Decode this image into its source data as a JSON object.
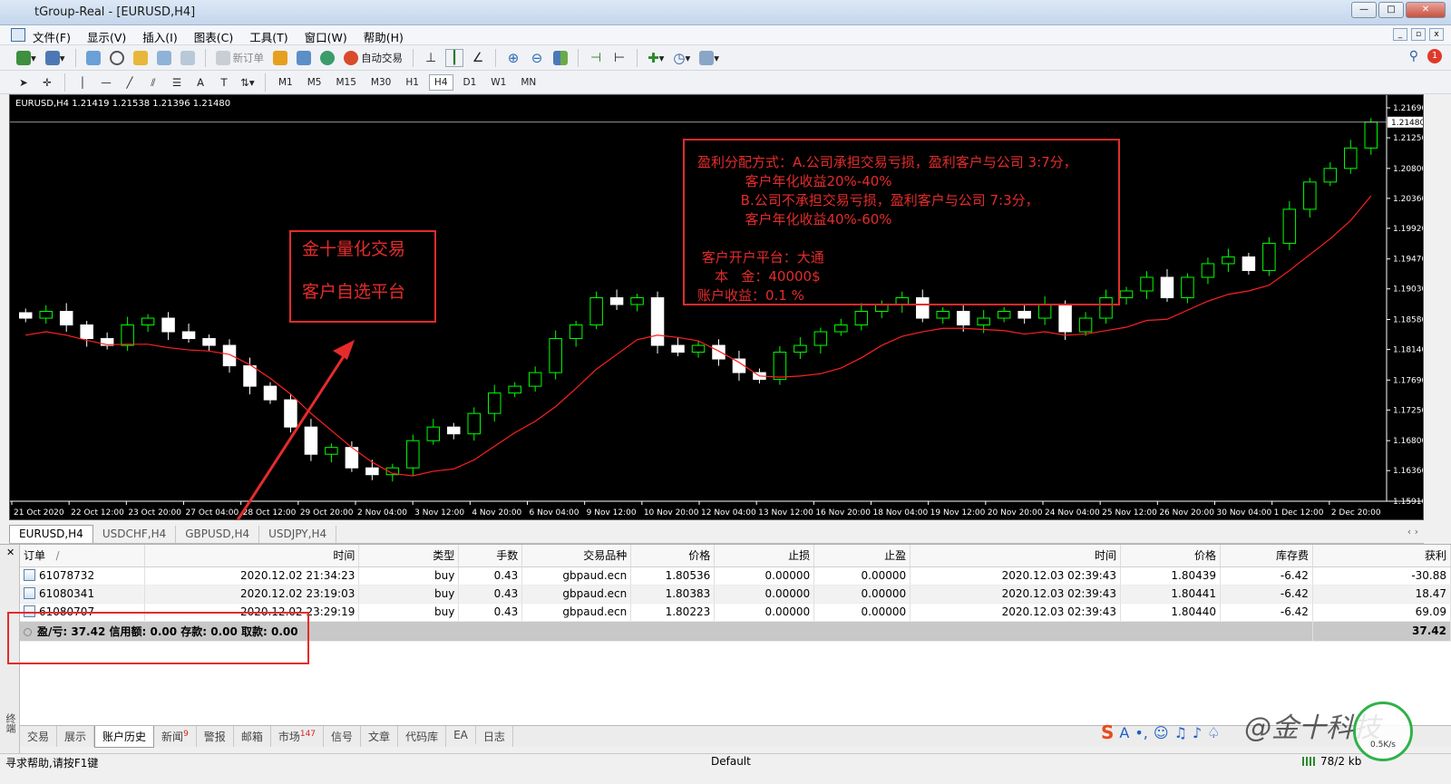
{
  "window": {
    "title": "tGroup-Real - [EURUSD,H4]"
  },
  "menu": [
    "文件(F)",
    "显示(V)",
    "插入(I)",
    "图表(C)",
    "工具(T)",
    "窗口(W)",
    "帮助(H)"
  ],
  "toolbar": {
    "new_order": "新订单",
    "auto_trading": "自动交易",
    "notify_count": "1"
  },
  "timeframes": [
    "M1",
    "M5",
    "M15",
    "M30",
    "H1",
    "H4",
    "D1",
    "W1",
    "MN"
  ],
  "active_timeframe": "H4",
  "chart": {
    "header": "EURUSD,H4  1.21419 1.21538 1.21396 1.21480",
    "current_price": "1.21480",
    "price_ticks": [
      "1.21690",
      "1.21250",
      "1.20800",
      "1.20360",
      "1.19920",
      "1.19470",
      "1.19030",
      "1.18580",
      "1.18140",
      "1.17690",
      "1.17250",
      "1.16800",
      "1.16360",
      "1.15910"
    ],
    "time_ticks": [
      "21 Oct 2020",
      "22 Oct 12:00",
      "23 Oct 20:00",
      "27 Oct 04:00",
      "28 Oct 12:00",
      "29 Oct 20:00",
      "2 Nov 04:00",
      "3 Nov 12:00",
      "4 Nov 20:00",
      "6 Nov 04:00",
      "9 Nov 12:00",
      "10 Nov 20:00",
      "12 Nov 04:00",
      "13 Nov 12:00",
      "16 Nov 20:00",
      "18 Nov 04:00",
      "19 Nov 12:00",
      "20 Nov 20:00",
      "24 Nov 04:00",
      "25 Nov 12:00",
      "26 Nov 20:00",
      "30 Nov 04:00",
      "1 Dec 12:00",
      "2 Dec 20:00"
    ],
    "colors": {
      "bull": "#00ff00",
      "bear": "#ffffff",
      "ma": "#ff2020",
      "grid_text": "#ffffff"
    }
  },
  "chart_data": {
    "type": "candlestick",
    "symbol": "EURUSD",
    "timeframe": "H4",
    "ylim": [
      1.1591,
      1.2169
    ],
    "close": [
      1.186,
      1.187,
      1.185,
      1.183,
      1.182,
      1.185,
      1.186,
      1.184,
      1.183,
      1.182,
      1.179,
      1.176,
      1.174,
      1.17,
      1.166,
      1.167,
      1.164,
      1.163,
      1.164,
      1.168,
      1.17,
      1.169,
      1.172,
      1.175,
      1.176,
      1.178,
      1.183,
      1.185,
      1.189,
      1.188,
      1.189,
      1.182,
      1.181,
      1.182,
      1.18,
      1.178,
      1.177,
      1.181,
      1.182,
      1.184,
      1.185,
      1.187,
      1.188,
      1.189,
      1.186,
      1.187,
      1.185,
      1.186,
      1.187,
      1.186,
      1.188,
      1.184,
      1.186,
      1.189,
      1.19,
      1.192,
      1.189,
      1.192,
      1.194,
      1.195,
      1.193,
      1.197,
      1.202,
      1.206,
      1.208,
      1.211,
      1.2148
    ]
  },
  "annotations": {
    "box1": {
      "line1": "金十量化交易",
      "line2": "客户自选平台"
    },
    "box2": [
      "盈利分配方式：A.公司承担交易亏损，盈利客户与公司 3:7分，",
      "           客户年化收益20%-40%",
      "          B.公司不承担交易亏损，盈利客户与公司 7:3分，",
      "           客户年化收益40%-60%",
      "",
      " 客户开户平台：大通",
      "    本   金：40000$",
      "账户收益：0.1 %"
    ]
  },
  "symbol_tabs": [
    "EURUSD,H4",
    "USDCHF,H4",
    "GBPUSD,H4",
    "USDJPY,H4"
  ],
  "terminal": {
    "columns": [
      "订单",
      "时间",
      "类型",
      "手数",
      "交易品种",
      "价格",
      "止损",
      "止盈",
      "时间",
      "价格",
      "库存费",
      "获利"
    ],
    "sort_marker": "/",
    "rows": [
      [
        "61078732",
        "2020.12.02 21:34:23",
        "buy",
        "0.43",
        "gbpaud.ecn",
        "1.80536",
        "0.00000",
        "0.00000",
        "2020.12.03 02:39:43",
        "1.80439",
        "-6.42",
        "-30.88"
      ],
      [
        "61080341",
        "2020.12.02 23:19:03",
        "buy",
        "0.43",
        "gbpaud.ecn",
        "1.80383",
        "0.00000",
        "0.00000",
        "2020.12.03 02:39:43",
        "1.80441",
        "-6.42",
        "18.47"
      ],
      [
        "61080707",
        "2020.12.02 23:29:19",
        "buy",
        "0.43",
        "gbpaud.ecn",
        "1.80223",
        "0.00000",
        "0.00000",
        "2020.12.03 02:39:43",
        "1.80440",
        "-6.42",
        "69.09"
      ]
    ],
    "summary": "盈/亏: 37.42  信用额: 0.00  存款: 0.00  取款: 0.00",
    "summary_total": "37.42",
    "side_label": "终端"
  },
  "bottom_tabs": [
    {
      "label": "交易",
      "badge": ""
    },
    {
      "label": "展示",
      "badge": ""
    },
    {
      "label": "账户历史",
      "badge": ""
    },
    {
      "label": "新闻",
      "badge": "9"
    },
    {
      "label": "警报",
      "badge": ""
    },
    {
      "label": "邮箱",
      "badge": ""
    },
    {
      "label": "市场",
      "badge": "147"
    },
    {
      "label": "信号",
      "badge": ""
    },
    {
      "label": "文章",
      "badge": ""
    },
    {
      "label": "代码库",
      "badge": ""
    },
    {
      "label": "EA",
      "badge": ""
    },
    {
      "label": "日志",
      "badge": ""
    }
  ],
  "active_bottom_tab": "账户历史",
  "status": {
    "help": "寻求帮助,请按F1键",
    "profile": "Default",
    "traffic": "78/2 kb"
  },
  "overlay": {
    "ime_logo": "S",
    "watermark": "@金十科技",
    "net_speed": "0.5K/s"
  }
}
